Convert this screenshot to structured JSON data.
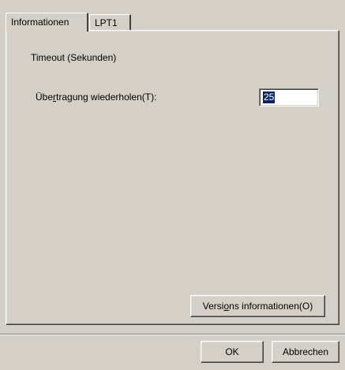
{
  "tabs": [
    {
      "label": "Informationen",
      "active": true
    },
    {
      "label": "LPT1",
      "active": false
    }
  ],
  "timeout_group": {
    "title": "Timeout (Sekunden)",
    "retry_label_pre": "Übe",
    "retry_label_mnemonic": "r",
    "retry_label_post": "tragung wiederholen(T):",
    "retry_value": "25"
  },
  "buttons": {
    "version_info_pre": "Versi",
    "version_info_mnemonic": "o",
    "version_info_post": "ns informationen(O)",
    "ok": "OK",
    "cancel": "Abbrechen"
  },
  "colors": {
    "face": "#d4d0c8",
    "selection": "#0a246a"
  }
}
